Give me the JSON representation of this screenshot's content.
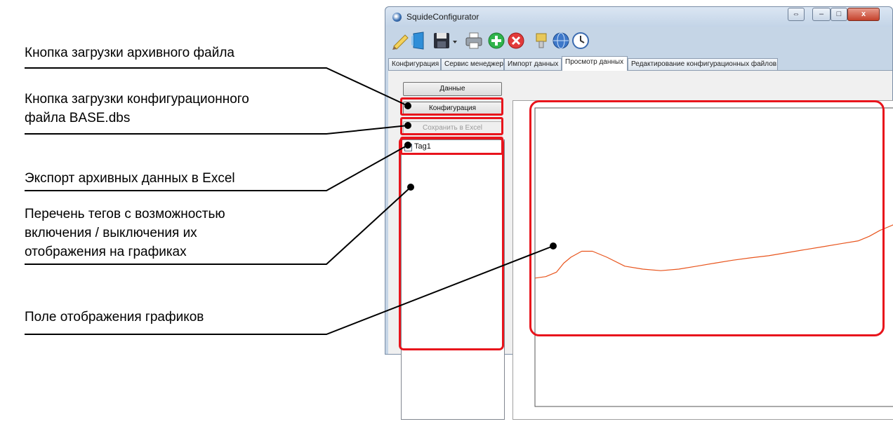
{
  "callouts": [
    {
      "id": "load-archive",
      "text": "Кнопка загрузки архивного файла"
    },
    {
      "id": "load-config",
      "text": "Кнопка загрузки конфигурационного\nфайла BASE.dbs"
    },
    {
      "id": "export-excel",
      "text": "Экспорт архивных данных в Excel"
    },
    {
      "id": "tag-list",
      "text": "Перечень тегов с возможностью\nвключения / выключения их\nотображения на графиках"
    },
    {
      "id": "chart-area",
      "text": "Поле отображения графиков"
    }
  ],
  "window": {
    "title": "SquideConfigurator",
    "controls": {
      "restore": "⇔",
      "minimize": "–",
      "maximize": "□",
      "close": "x"
    }
  },
  "toolbar": {
    "icons": [
      "pencil-icon",
      "open-folder-icon",
      "save-icon",
      "dropdown-arrow-icon",
      "print-icon",
      "add-icon",
      "delete-icon",
      "connector-icon",
      "network-icon",
      "clock-icon"
    ]
  },
  "tabs": [
    {
      "label": "Конфигурация",
      "active": false
    },
    {
      "label": "Сервис менеджер",
      "active": false
    },
    {
      "label": "Импорт данных",
      "active": false
    },
    {
      "label": "Просмотр данных",
      "active": true
    },
    {
      "label": "Редактирование конфигурационных файлов",
      "active": false
    }
  ],
  "panel": {
    "data_button": "Данные",
    "config_button": "Конфигурация",
    "excel_button": "Сохранить в Excel",
    "tags": [
      {
        "name": "Tag1",
        "checked": true
      }
    ]
  },
  "colors": {
    "highlight": "#e8141c",
    "series": "#e8541c",
    "window_frame": "#c5d5e6"
  },
  "chart_data": {
    "type": "line",
    "title": "",
    "xlabel": "",
    "ylabel": "",
    "x": [
      0,
      3,
      6,
      8,
      10,
      13,
      16,
      20,
      25,
      30,
      35,
      40,
      45,
      50,
      55,
      60,
      65,
      70,
      75,
      80,
      85,
      90,
      93,
      96,
      100
    ],
    "series": [
      {
        "values": [
          43,
          43.5,
          45,
          48,
          50,
          52,
          52,
          50,
          47,
          46,
          45.5,
          46,
          47,
          48,
          49,
          49.8,
          50.5,
          51.5,
          52.5,
          53.5,
          54.5,
          55.5,
          57,
          59,
          61
        ]
      }
    ],
    "xlim": [
      0,
      100
    ],
    "ylim": [
      0,
      100
    ],
    "grid": false
  }
}
